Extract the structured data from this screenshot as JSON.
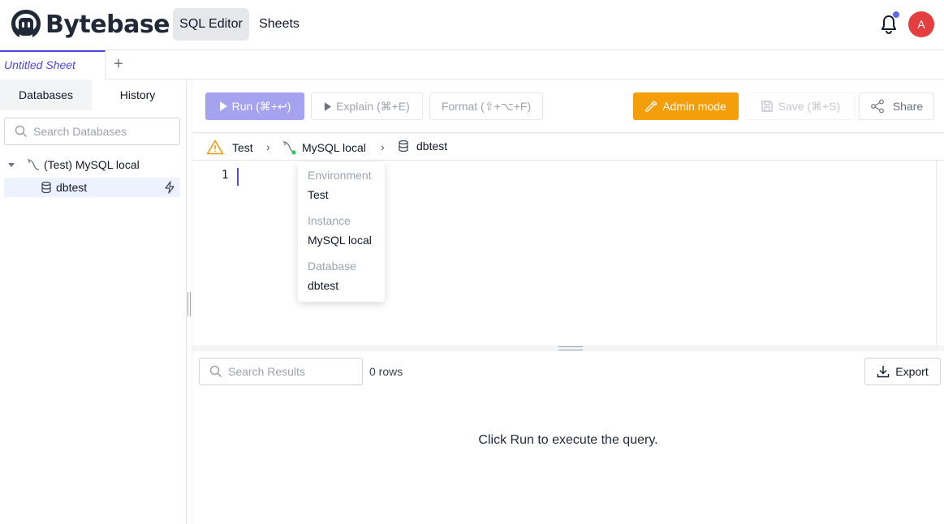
{
  "brand": {
    "name": "Bytebase"
  },
  "nav": {
    "sql_editor": "SQL Editor",
    "sheets": "Sheets"
  },
  "user": {
    "avatar_initial": "A"
  },
  "colors": {
    "accent": "#4f46e5",
    "run": "#a5a3f0",
    "admin": "#f59e0b",
    "avatar": "#e53e3e"
  },
  "sheet_tabs": {
    "active_label": "Untitled Sheet",
    "add_label": "+"
  },
  "sidebar": {
    "tabs": [
      "Databases",
      "History"
    ],
    "search_placeholder": "Search Databases",
    "instance_label": "(Test) MySQL local",
    "database_label": "dbtest"
  },
  "toolbar": {
    "run": "Run (⌘+↩)",
    "explain": "Explain (⌘+E)",
    "format": "Format (⇧+⌥+F)",
    "admin": "Admin mode",
    "save": "Save (⌘+S)",
    "share": "Share"
  },
  "breadcrumb": {
    "environment": "Test",
    "instance": "MySQL local",
    "database": "dbtest",
    "separator": "›"
  },
  "editor": {
    "line_number": "1"
  },
  "popover": {
    "environment_label": "Environment",
    "environment_value": "Test",
    "instance_label": "Instance",
    "instance_value": "MySQL local",
    "database_label": "Database",
    "database_value": "dbtest"
  },
  "results": {
    "search_placeholder": "Search Results",
    "rows": "0 rows",
    "export": "Export",
    "empty_message": "Click Run to execute the query."
  }
}
